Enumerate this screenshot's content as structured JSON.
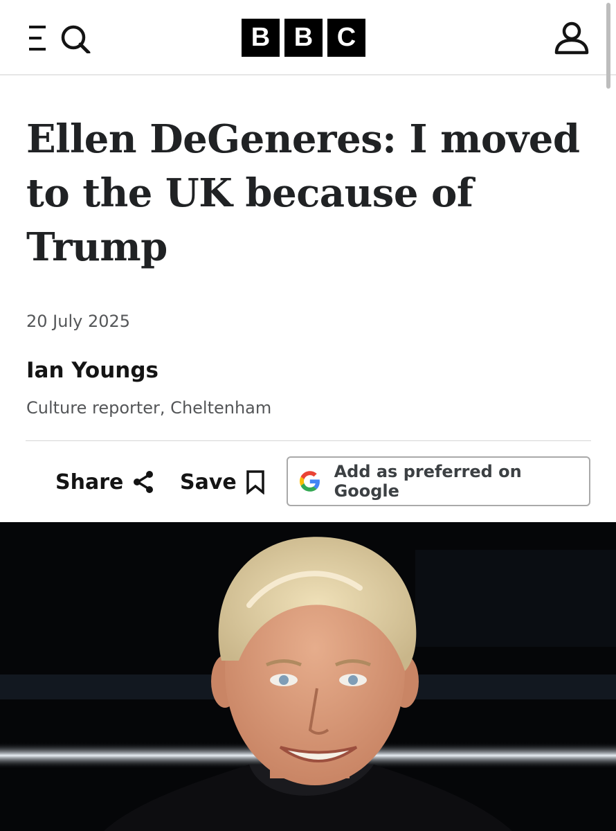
{
  "header": {
    "logo_letters": [
      "B",
      "B",
      "C"
    ],
    "menu_icon": "menu-icon",
    "search_icon": "search-icon",
    "account_icon": "account-icon"
  },
  "article": {
    "headline": "Ellen DeGeneres: I moved to the UK because of Trump",
    "date": "20 July 2025",
    "author_name": "Ian Youngs",
    "author_role": "Culture reporter, Cheltenham"
  },
  "actions": {
    "share_label": "Share",
    "share_icon": "share-icon",
    "save_label": "Save",
    "save_icon": "bookmark-icon",
    "google_label": "Add as preferred on Google",
    "google_icon": "google-g-icon"
  },
  "colors": {
    "brand_black": "#000000",
    "text_primary": "#141414",
    "text_secondary": "#545658"
  }
}
